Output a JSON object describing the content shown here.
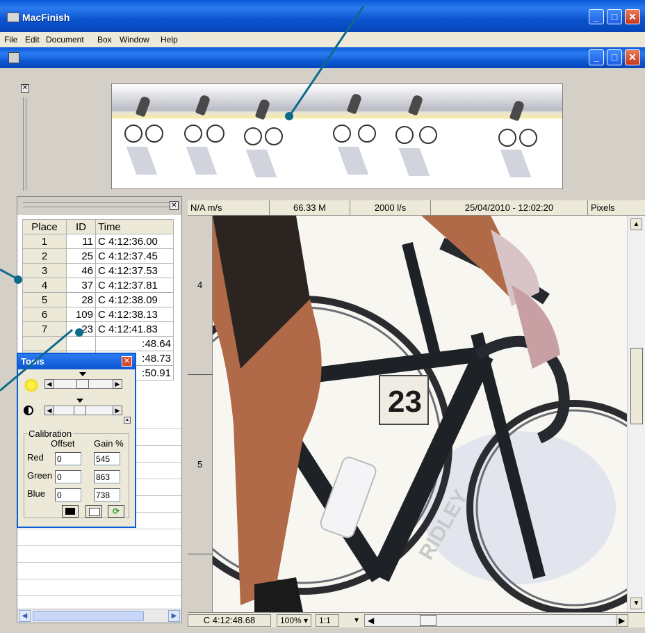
{
  "window": {
    "title": "MacFinish"
  },
  "menu": [
    "File",
    "Edit",
    "Document",
    "Box",
    "Window",
    "Help"
  ],
  "status_bar": {
    "speed": "N/A m/s",
    "distance": "66.33 M",
    "rate": "2000 l/s",
    "datetime": "25/04/2010 - 12:02:20",
    "units": "Pixels"
  },
  "results": {
    "headers": [
      "Place",
      "ID",
      "Time"
    ],
    "rows": [
      [
        "1",
        "11",
        "C 4:12:36.00"
      ],
      [
        "2",
        "25",
        "C 4:12:37.45"
      ],
      [
        "3",
        "46",
        "C 4:12:37.53"
      ],
      [
        "4",
        "37",
        "C 4:12:37.81"
      ],
      [
        "5",
        "28",
        "C 4:12:38.09"
      ],
      [
        "6",
        "109",
        "C 4:12:38.13"
      ],
      [
        "7",
        "23",
        "C 4:12:41.83"
      ]
    ],
    "hidden_times": [
      ":48.64",
      ":48.73",
      ":50.91"
    ]
  },
  "tools": {
    "title": "Tools",
    "calibration": {
      "label": "Calibration",
      "col_offset": "Offset",
      "col_gain": "Gain %",
      "channels": [
        {
          "name": "Red",
          "offset": "0",
          "gain": "545"
        },
        {
          "name": "Green",
          "offset": "0",
          "gain": "863"
        },
        {
          "name": "Blue",
          "offset": "0",
          "gain": "738"
        }
      ]
    }
  },
  "ruler": {
    "labels": [
      "4",
      "5"
    ]
  },
  "bottom_bar": {
    "time": "C 4:12:48.68",
    "zoom": "100% ▾",
    "ratio": "1:1",
    "ratio_arrow": "▾"
  },
  "photo": {
    "bib_number": "23",
    "frame_brand": "RIDLEY"
  }
}
